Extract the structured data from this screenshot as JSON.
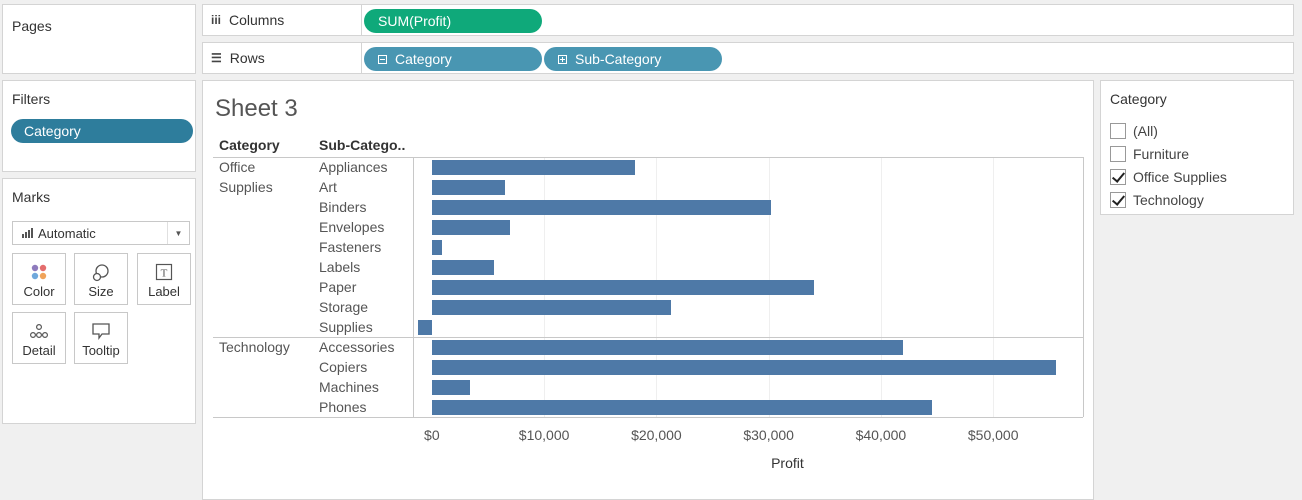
{
  "pages": {
    "title": "Pages"
  },
  "columns": {
    "label": "Columns",
    "icon": "columns-icon",
    "pills": [
      {
        "label": "SUM(Profit)",
        "color": "#0fa97a"
      }
    ]
  },
  "rows": {
    "label": "Rows",
    "icon": "rows-icon",
    "pills": [
      {
        "label": "Category",
        "color": "#4996b2"
      },
      {
        "label": "Sub-Category",
        "color": "#4996b2"
      }
    ]
  },
  "filters": {
    "title": "Filters",
    "pill": "Category"
  },
  "marks": {
    "title": "Marks",
    "type": "Automatic",
    "buttons": [
      {
        "label": "Color",
        "icon": "color-icon"
      },
      {
        "label": "Size",
        "icon": "size-icon"
      },
      {
        "label": "Label",
        "icon": "label-icon"
      },
      {
        "label": "Detail",
        "icon": "detail-icon"
      },
      {
        "label": "Tooltip",
        "icon": "tooltip-icon"
      }
    ]
  },
  "sheet": {
    "title": "Sheet 3",
    "col_headers": {
      "category": "Category",
      "subcategory": "Sub-Catego.."
    },
    "groups": [
      {
        "category": "Office Supplies",
        "category_lines": [
          "Office",
          "Supplies"
        ]
      },
      {
        "category": "Technology",
        "category_lines": [
          "Technology"
        ]
      }
    ]
  },
  "chart_data": {
    "type": "bar",
    "orientation": "horizontal",
    "categories": [
      "Appliances",
      "Art",
      "Binders",
      "Envelopes",
      "Fasteners",
      "Labels",
      "Paper",
      "Storage",
      "Supplies",
      "Accessories",
      "Copiers",
      "Machines",
      "Phones"
    ],
    "groups": [
      "Office Supplies",
      "Office Supplies",
      "Office Supplies",
      "Office Supplies",
      "Office Supplies",
      "Office Supplies",
      "Office Supplies",
      "Office Supplies",
      "Office Supplies",
      "Technology",
      "Technology",
      "Technology",
      "Technology"
    ],
    "values": [
      18138,
      6528,
      30222,
      6964,
      950,
      5546,
      34054,
      21279,
      -1189,
      41937,
      55618,
      3385,
      44516
    ],
    "xlabel": "Profit",
    "xlim": [
      -1500,
      58000
    ],
    "ticks": [
      0,
      10000,
      20000,
      30000,
      40000,
      50000
    ],
    "tick_labels": [
      "$0",
      "$10,000",
      "$20,000",
      "$30,000",
      "$40,000",
      "$50,000"
    ],
    "bar_color": "#4e79a7",
    "grid": true
  },
  "category_filter": {
    "title": "Category",
    "options": [
      {
        "label": "(All)",
        "checked": false
      },
      {
        "label": "Furniture",
        "checked": false
      },
      {
        "label": "Office Supplies",
        "checked": true
      },
      {
        "label": "Technology",
        "checked": true
      }
    ]
  }
}
